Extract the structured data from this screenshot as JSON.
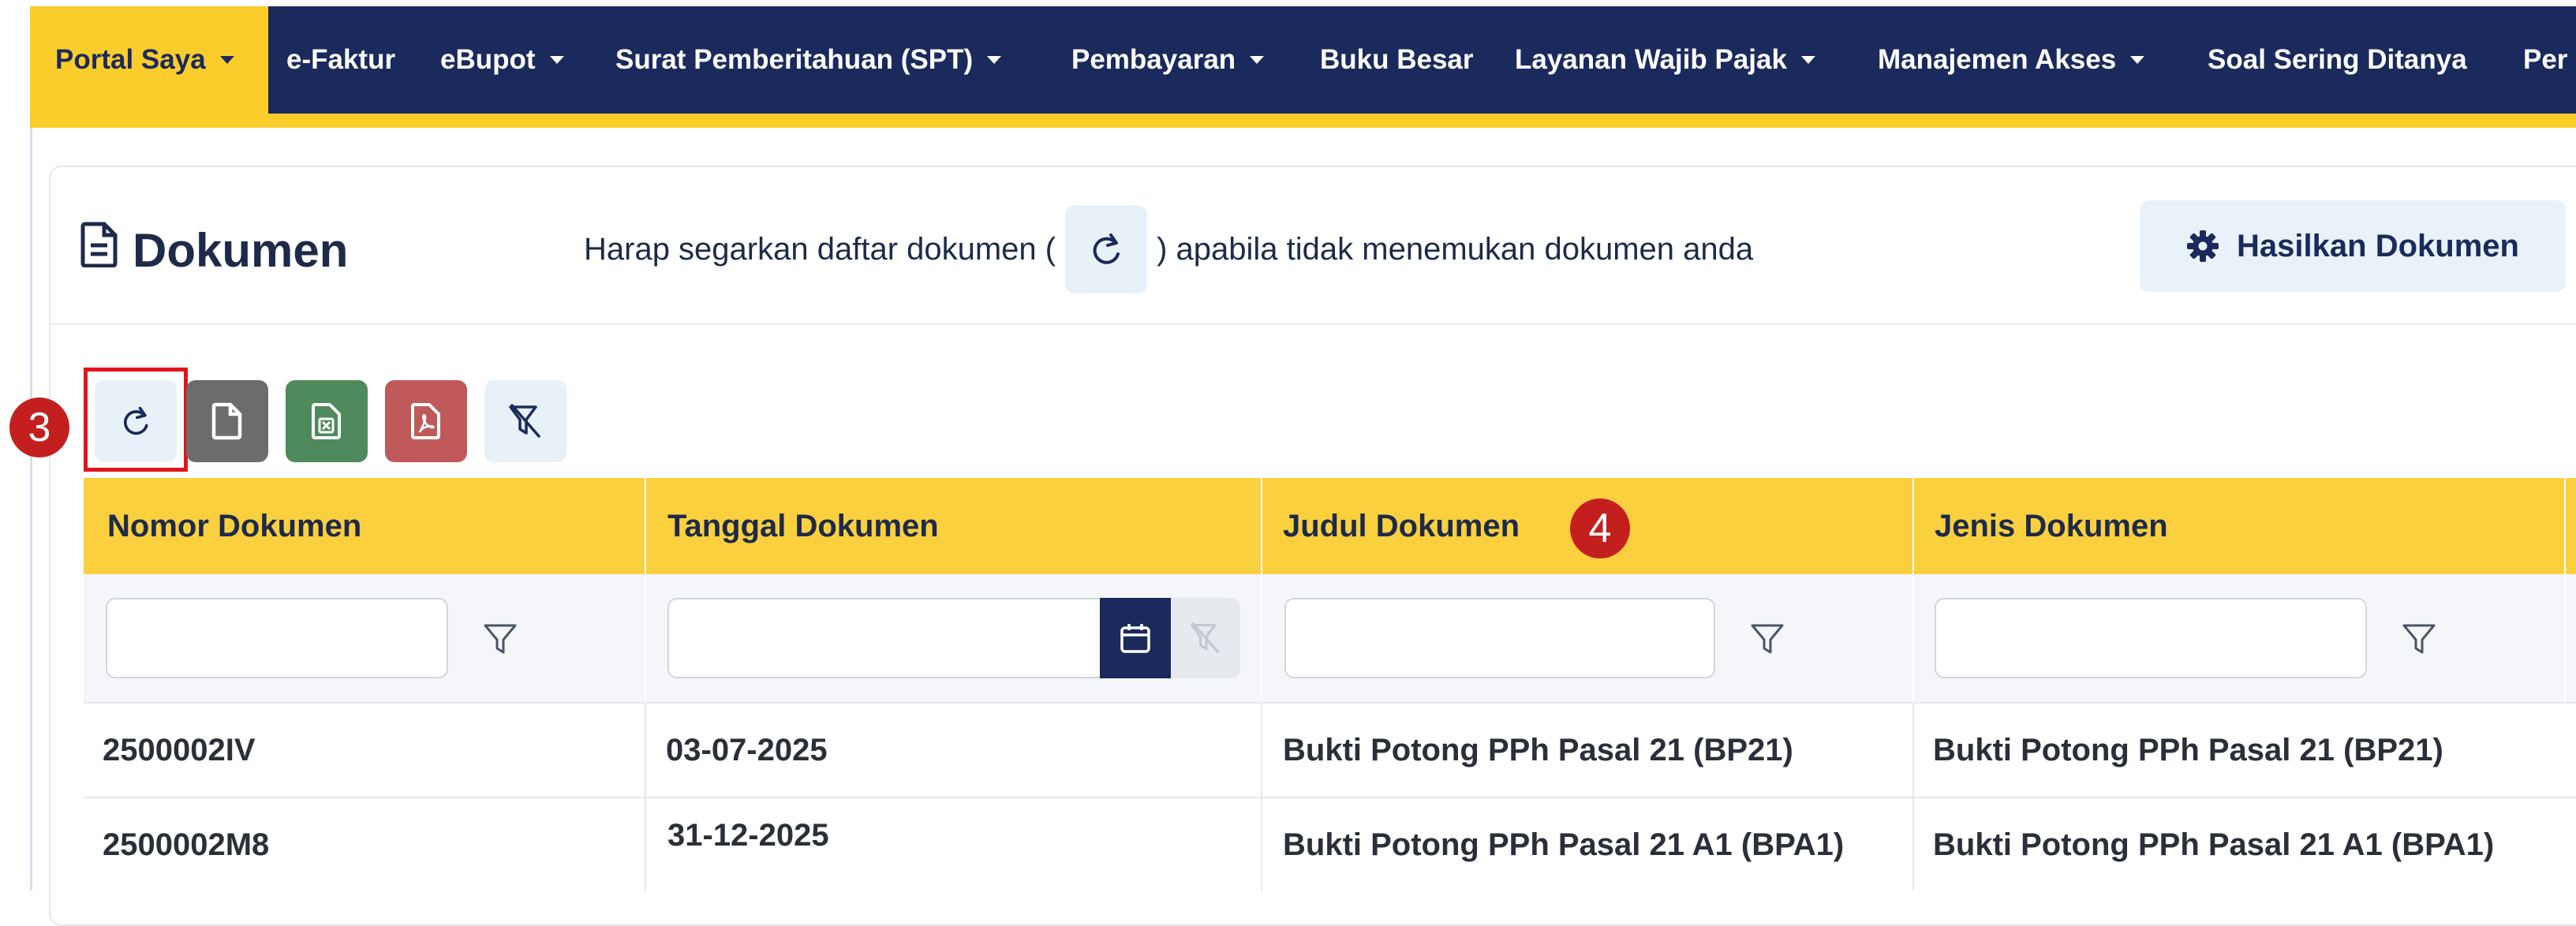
{
  "nav": {
    "items": [
      {
        "label": "Portal Saya",
        "dropdown": true,
        "active": true
      },
      {
        "label": "e-Faktur",
        "dropdown": false
      },
      {
        "label": "eBupot",
        "dropdown": true
      },
      {
        "label": "Surat Pemberitahuan (SPT)",
        "dropdown": true
      },
      {
        "label": "Pembayaran",
        "dropdown": true
      },
      {
        "label": "Buku Besar",
        "dropdown": false
      },
      {
        "label": "Layanan Wajib Pajak",
        "dropdown": true
      },
      {
        "label": "Manajemen Akses",
        "dropdown": true
      },
      {
        "label": "Soal Sering Ditanya",
        "dropdown": false
      },
      {
        "label": "Per",
        "dropdown": false
      }
    ]
  },
  "page": {
    "title": "Dokumen",
    "hint_before": "Harap segarkan daftar dokumen (",
    "hint_after": ") apabila tidak menemukan dokumen anda",
    "generate_label": "Hasilkan Dokumen"
  },
  "toolbar": {
    "buttons": [
      {
        "name": "refresh-button",
        "icon": "refresh-icon",
        "color": "#e8f1f8"
      },
      {
        "name": "export-file-button",
        "icon": "file-icon",
        "color": "#6c6c6c"
      },
      {
        "name": "export-excel-button",
        "icon": "excel-icon",
        "color": "#4e8a5c"
      },
      {
        "name": "export-pdf-button",
        "icon": "pdf-icon",
        "color": "#c05a5a"
      },
      {
        "name": "clear-filter-button",
        "icon": "filter-clear-icon",
        "color": "#e8f1f8"
      }
    ]
  },
  "markers": {
    "m3": "3",
    "m4": "4"
  },
  "table": {
    "columns": [
      "Nomor Dokumen",
      "Tanggal Dokumen",
      "Judul Dokumen",
      "Jenis Dokumen"
    ],
    "rows": [
      [
        "2500002IV",
        "03-07-2025",
        "Bukti Potong PPh Pasal 21 (BP21)",
        "Bukti Potong PPh Pasal 21 (BP21)"
      ],
      [
        "2500002M8",
        "31-12-2025",
        "Bukti Potong PPh Pasal 21 A1 (BPA1)",
        "Bukti Potong PPh Pasal 21 A1 (BPA1)"
      ]
    ]
  },
  "colors": {
    "nav_bg": "#1b2a5c",
    "accent": "#fbcd2b",
    "marker": "#c41f1f"
  }
}
